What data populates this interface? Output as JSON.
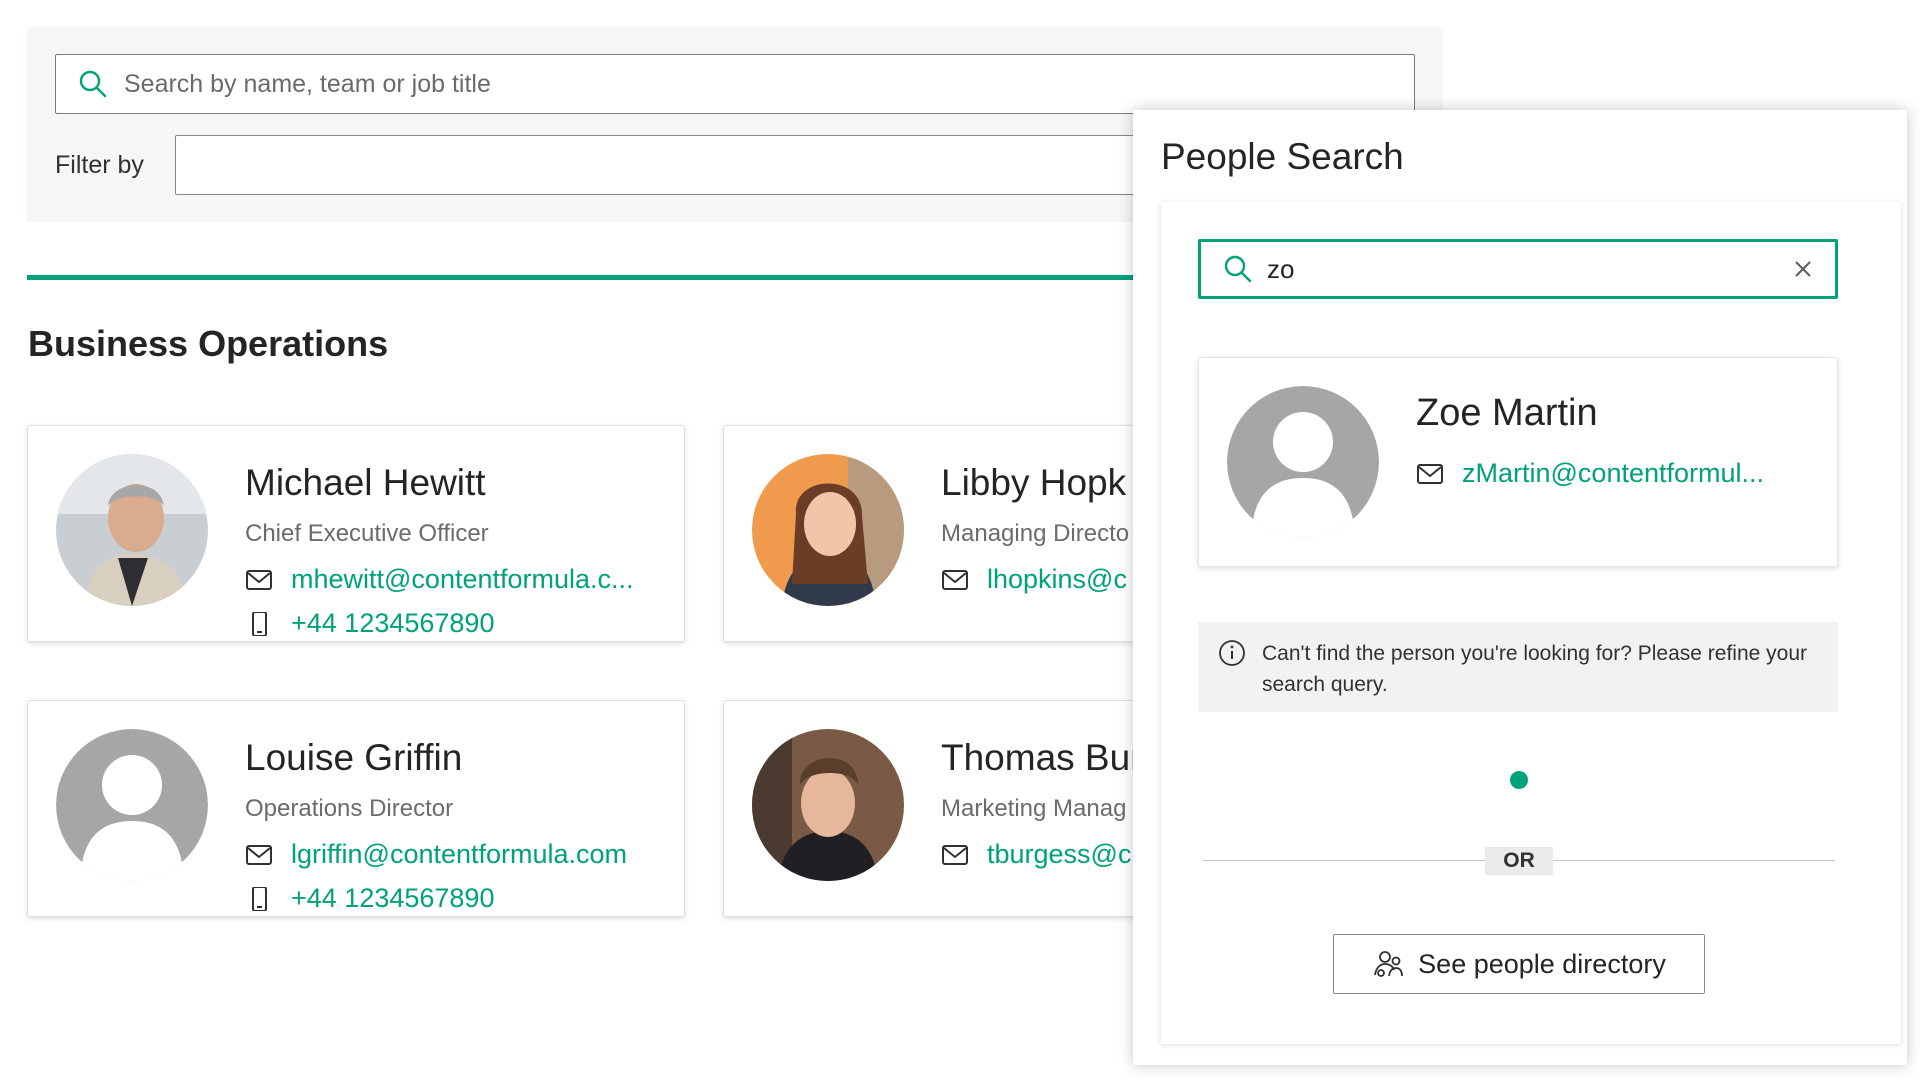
{
  "search": {
    "placeholder": "Search by name, team or job title"
  },
  "filter": {
    "label": "Filter by",
    "value": ""
  },
  "section": {
    "title": "Business Operations"
  },
  "people": [
    {
      "name": "Michael Hewitt",
      "title": "Chief Executive Officer",
      "email": "mhewitt@contentformula.c...",
      "phone": "+44 1234567890"
    },
    {
      "name": "Libby Hopk",
      "title": "Managing Directo",
      "email": "lhopkins@c"
    },
    {
      "name": "Louise Griffin",
      "title": "Operations Director",
      "email": "lgriffin@contentformula.com",
      "phone": "+44 1234567890"
    },
    {
      "name": "Thomas Bur",
      "title": "Marketing Manag",
      "email": "tburgess@c"
    }
  ],
  "people_search": {
    "heading": "People Search",
    "query": "zo",
    "result": {
      "name": "Zoe Martin",
      "email": "zMartin@contentformul..."
    },
    "notice": "Can't find the person you're looking for? Please refine your search query.",
    "or_label": "OR",
    "directory_button": "See people directory"
  },
  "colors": {
    "accent": "#00a27a",
    "panel_bg": "#f7f6f4",
    "avatar_placeholder": "#a6a6a6"
  },
  "icons": [
    "search-icon",
    "mail-icon",
    "phone-icon",
    "close-icon",
    "info-icon",
    "people-directory-icon"
  ]
}
